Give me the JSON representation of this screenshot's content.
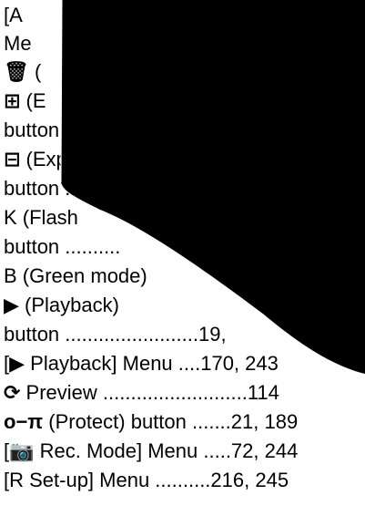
{
  "index_lines": [
    {
      "icon": "",
      "text": "[A"
    },
    {
      "icon": "",
      "text": "Me"
    },
    {
      "icon": "🗑",
      "text": " ("
    },
    {
      "icon": "⊞",
      "text": " (E"
    },
    {
      "icon": "",
      "text": "button"
    },
    {
      "icon": "⊟",
      "text": " (Exp"
    },
    {
      "icon": "",
      "text": "button ..."
    },
    {
      "icon": "",
      "text": "K    (Flash"
    },
    {
      "icon": "",
      "text": "button .........."
    },
    {
      "icon": "",
      "text": "B  (Green mode)"
    },
    {
      "icon": "▶",
      "text": " (Playback)"
    },
    {
      "icon": "",
      "text": "button ........................19,"
    },
    {
      "icon": "",
      "text": "[▶ Playback] Menu ....170, 243"
    },
    {
      "icon": "⟳",
      "text": " Preview ..........................114"
    },
    {
      "icon": "o−π",
      "text": " (Protect) button .......21, 189"
    },
    {
      "icon": "",
      "text": "[📷 Rec. Mode] Menu .....72, 244"
    },
    {
      "icon": "",
      "text": "[R Set-up] Menu ..........216, 245"
    }
  ],
  "colors": {
    "background": "#ffffff",
    "text": "#000000",
    "cover": "#000000"
  }
}
